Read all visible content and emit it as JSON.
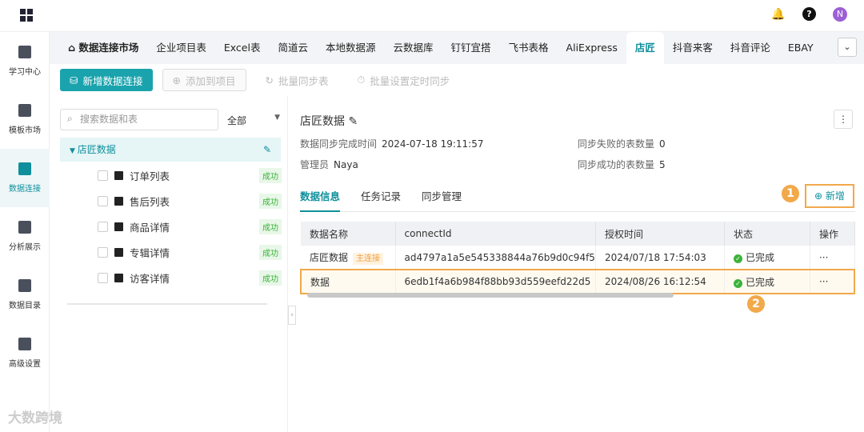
{
  "sidebar": {
    "items": [
      {
        "label": "学习中心"
      },
      {
        "label": "模板市场"
      },
      {
        "label": "数据连接"
      },
      {
        "label": "分析展示"
      },
      {
        "label": "数据目录"
      },
      {
        "label": "高级设置"
      }
    ]
  },
  "topbar": {
    "avatar": "N"
  },
  "tabs": [
    "数据连接市场",
    "企业项目表",
    "Excel表",
    "简道云",
    "本地数据源",
    "云数据库",
    "钉钉宜搭",
    "飞书表格",
    "AliExpress",
    "店匠",
    "抖音来客",
    "抖音评论",
    "EBAY"
  ],
  "toolbar": {
    "new_conn": "新增数据连接",
    "add_project": "添加到项目",
    "batch_sync": "批量同步表",
    "batch_timer": "批量设置定时同步"
  },
  "left": {
    "search_placeholder": "搜索数据和表",
    "filter": "全部",
    "root": "店匠数据",
    "items": [
      {
        "name": "订单列表",
        "status": "成功"
      },
      {
        "name": "售后列表",
        "status": "成功"
      },
      {
        "name": "商品详情",
        "status": "成功"
      },
      {
        "name": "专辑详情",
        "status": "成功"
      },
      {
        "name": "访客详情",
        "status": "成功"
      }
    ]
  },
  "detail": {
    "title": "店匠数据",
    "sync_time_label": "数据同步完成时间",
    "sync_time": "2024-07-18 19:11:57",
    "admin_label": "管理员",
    "admin": "Naya",
    "fail_label": "同步失败的表数量",
    "fail": "0",
    "success_label": "同步成功的表数量",
    "success": "5",
    "tabs": [
      "数据信息",
      "任务记录",
      "同步管理"
    ],
    "add": "新增",
    "step1": "1",
    "step2": "2",
    "columns": [
      "数据名称",
      "connectId",
      "授权时间",
      "状态",
      "操作"
    ],
    "rows": [
      {
        "name": "店匠数据",
        "badge": "主连接",
        "id": "ad4797a1a5e545338844a76b9d0c94f5",
        "time": "2024/07/18 17:54:03",
        "status": "已完成",
        "op": "···"
      },
      {
        "name": "数据",
        "id": "6edb1f4a6b984f88bb93d559eefd22d5",
        "time": "2024/08/26 16:12:54",
        "status": "已完成",
        "op": "···"
      }
    ]
  },
  "watermark": "大数跨境"
}
